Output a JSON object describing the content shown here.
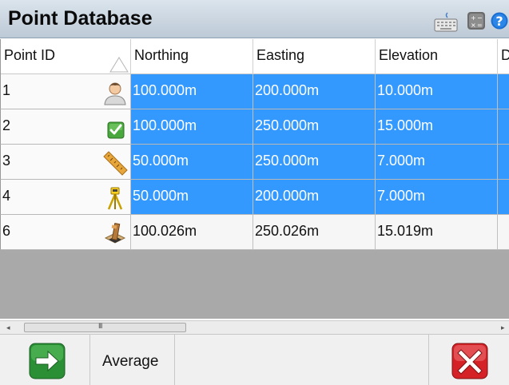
{
  "window": {
    "title": "Point Database"
  },
  "toolbar": {
    "keyboard_icon": "keyboard-icon",
    "calculator_icon": "calculator-icon",
    "help_icon": "help-icon"
  },
  "grid": {
    "columns": [
      "Point ID",
      "Northing",
      "Easting",
      "Elevation",
      "D"
    ],
    "rows": [
      {
        "id": "1",
        "icon": "person-icon",
        "northing": "100.000m",
        "easting": "200.000m",
        "elevation": "10.000m",
        "selected": true
      },
      {
        "id": "2",
        "icon": "check-icon",
        "northing": "100.000m",
        "easting": "250.000m",
        "elevation": "15.000m",
        "selected": true
      },
      {
        "id": "3",
        "icon": "ruler-icon",
        "northing": "50.000m",
        "easting": "250.000m",
        "elevation": "7.000m",
        "selected": true
      },
      {
        "id": "4",
        "icon": "tripod-icon",
        "northing": "50.000m",
        "easting": "200.000m",
        "elevation": "7.000m",
        "selected": true
      },
      {
        "id": "6",
        "icon": "survey-stake-icon",
        "northing": "100.026m",
        "easting": "250.026m",
        "elevation": "15.019m",
        "selected": false
      }
    ]
  },
  "scrollbar": {
    "left_arrow": "◂",
    "grip": "III",
    "right_arrow": "▸"
  },
  "footer": {
    "average_label": "Average"
  },
  "colors": {
    "selection": "#3399ff",
    "ok_green": "#2e9e3a",
    "cancel_red": "#d8262a"
  }
}
